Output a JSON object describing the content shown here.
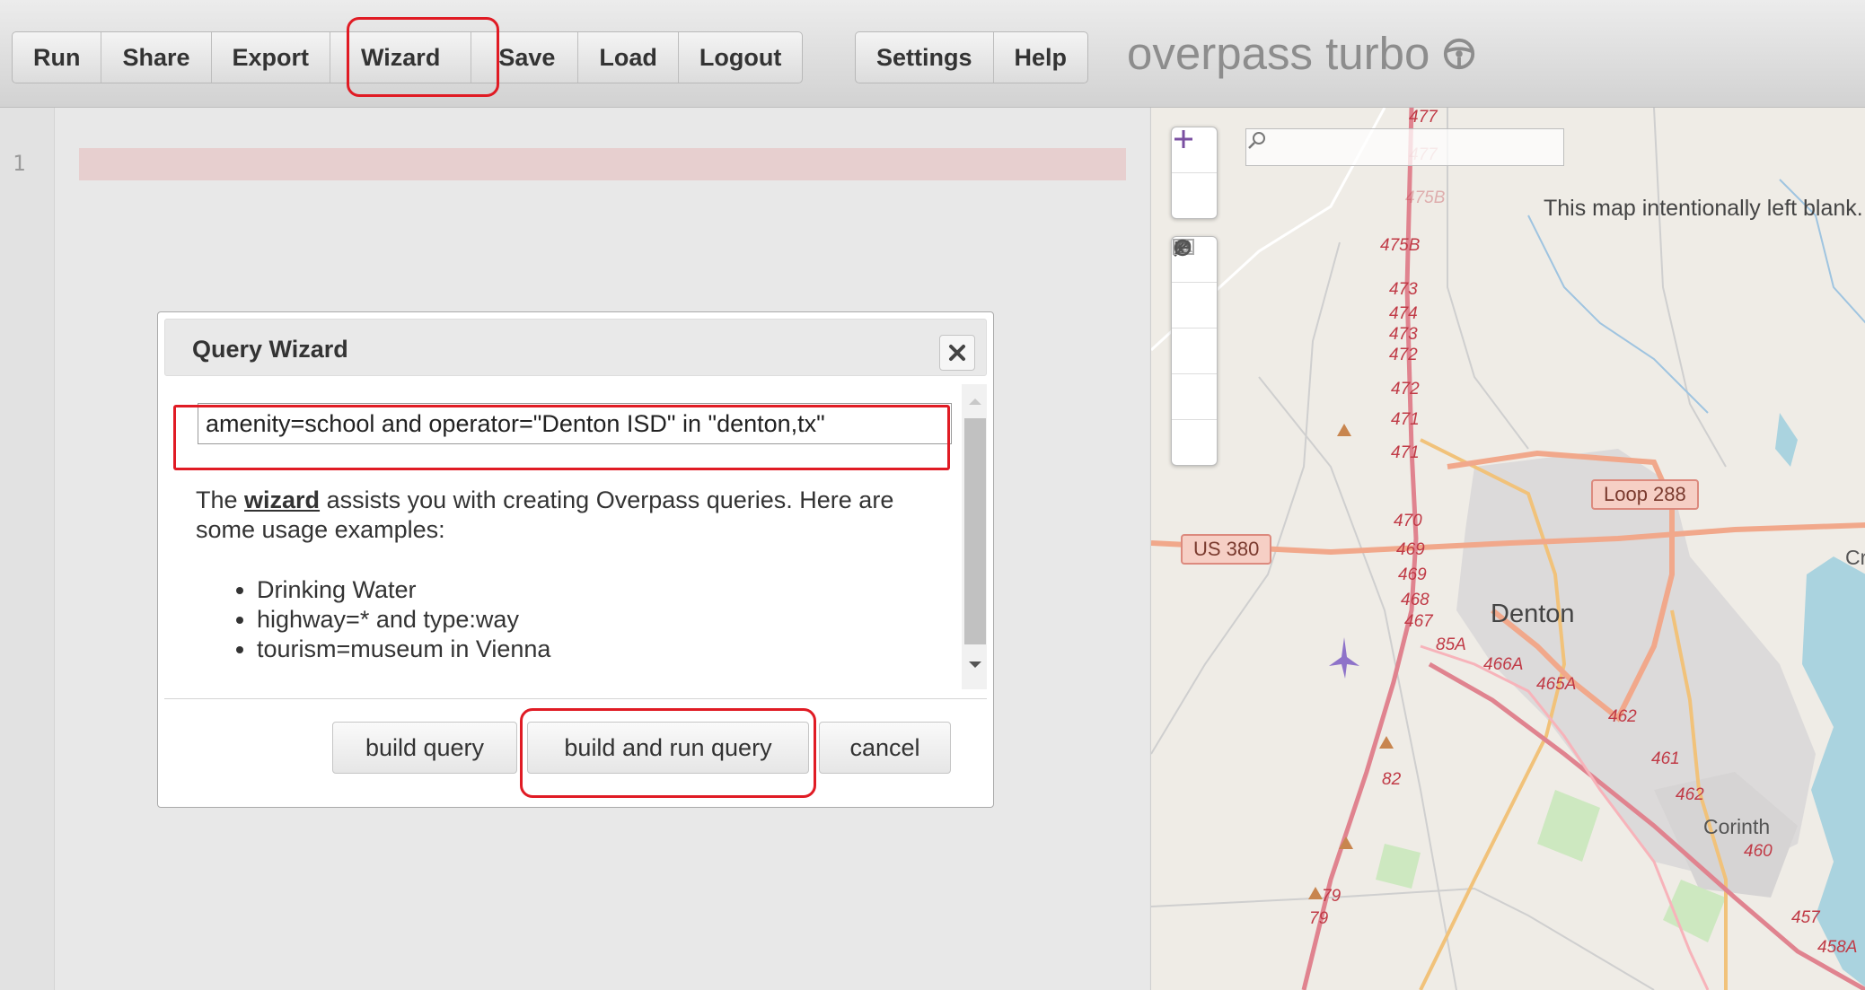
{
  "toolbar": {
    "group1": [
      "Run",
      "Share",
      "Export",
      "Wizard",
      "Save",
      "Load",
      "Logout"
    ],
    "group2": [
      "Settings",
      "Help"
    ],
    "brand": "overpass turbo"
  },
  "editor": {
    "line_number": "1"
  },
  "dialog": {
    "title": "Query Wizard",
    "query_value": "amenity=school and operator=\"Denton ISD\" in \"denton,tx\"",
    "desc_before": "The ",
    "desc_link": "wizard",
    "desc_after": " assists you with creating Overpass queries. Here are some usage examples:",
    "examples": [
      "Drinking Water",
      "highway=* and type:way",
      "tourism=museum in Vienna"
    ],
    "buttons": {
      "build": "build query",
      "build_run": "build and run query",
      "cancel": "cancel"
    }
  },
  "map": {
    "notice": "This map intentionally left blank.",
    "shields": [
      "US 380",
      "Loop 288"
    ],
    "places": [
      "Denton",
      "Corinth",
      "Cr"
    ],
    "exits": [
      "477",
      "477",
      "475B",
      "475B",
      "473",
      "474",
      "473",
      "472",
      "472",
      "471",
      "471",
      "470",
      "469",
      "469",
      "468",
      "467",
      "85A",
      "466A",
      "465A",
      "462",
      "461",
      "462",
      "460",
      "457",
      "458A",
      "82",
      "79",
      "79"
    ]
  },
  "colors": {
    "highlight": "#e01b24",
    "accent": "#7a4fa1"
  }
}
